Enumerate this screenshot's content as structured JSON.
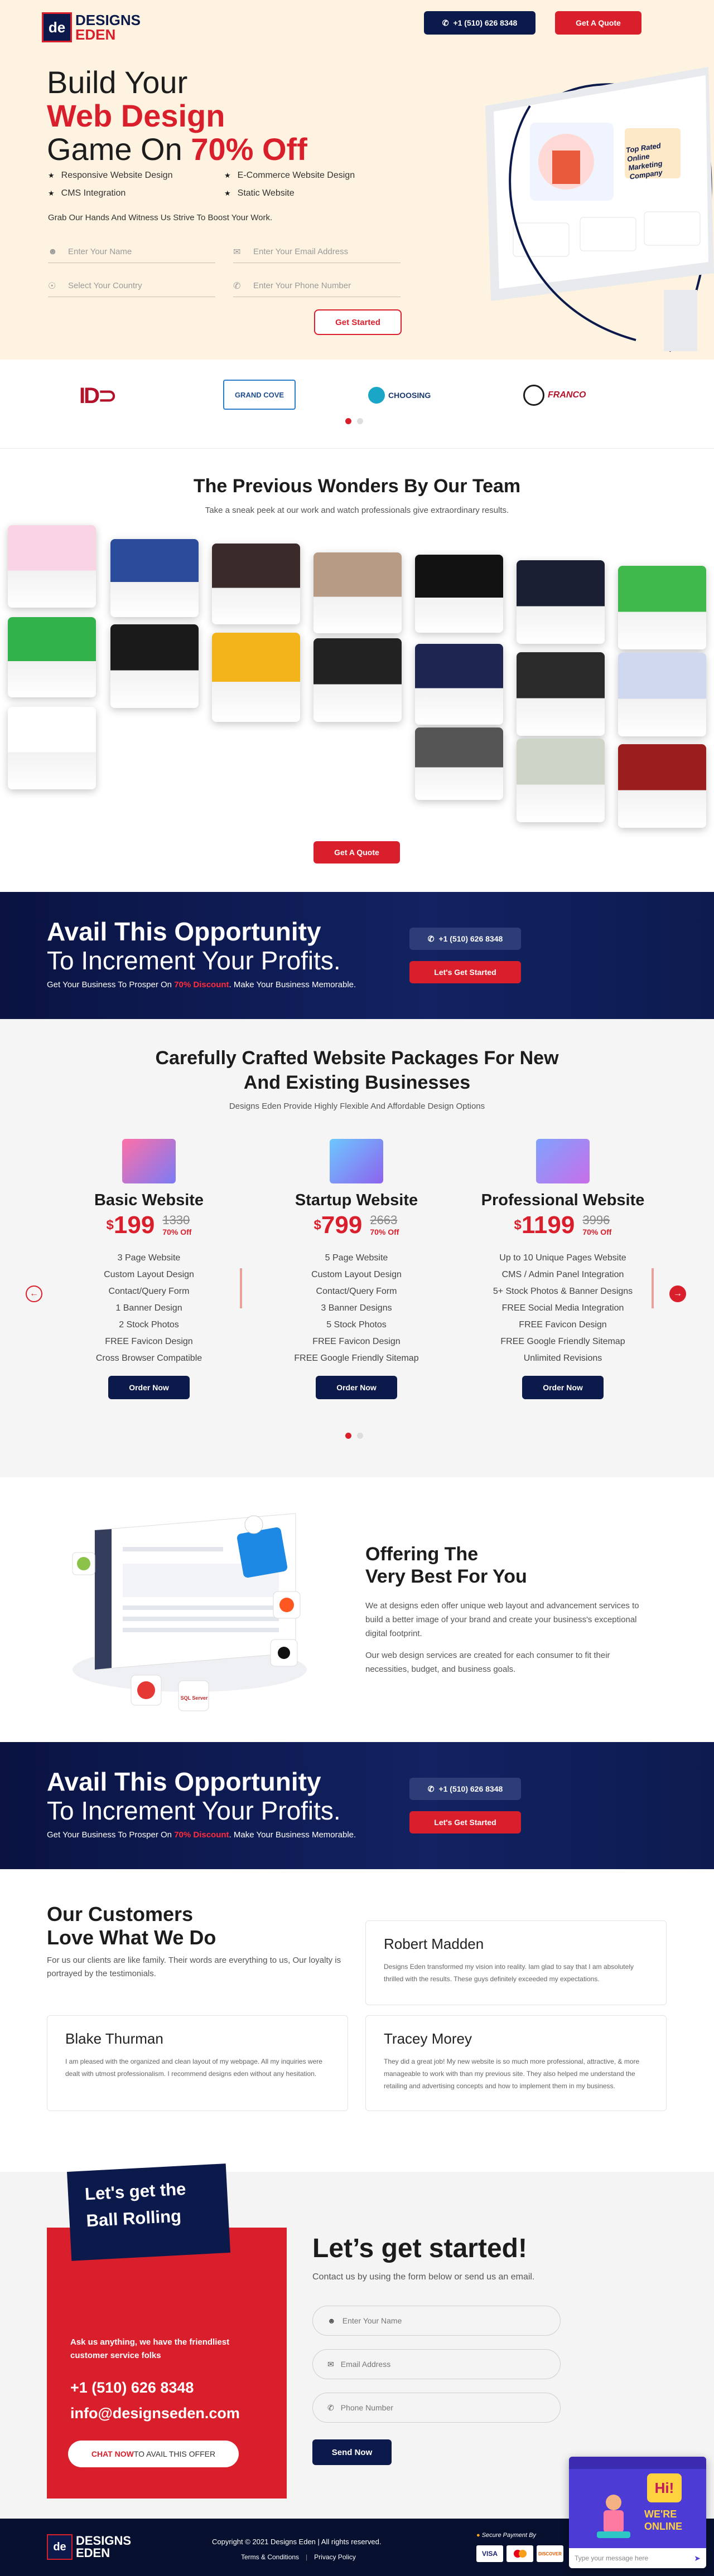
{
  "brand": {
    "line1": "DESIGNS",
    "line2": "EDEN",
    "mark": "de"
  },
  "header": {
    "phone": "+1 (510) 626 8348",
    "quote": "Get A Quote"
  },
  "hero": {
    "l1": "Build Your",
    "l2": "Web Design",
    "l3a": "Game On ",
    "l3b": "70% Off",
    "features": [
      "Responsive Website Design",
      "E-Commerce Website Design",
      "CMS Integration",
      "Static Website"
    ],
    "tagline": "Grab Our Hands And Witness Us Strive To Boost Your Work.",
    "fields": {
      "name": "Enter Your Name",
      "email": "Enter Your Email Address",
      "country": "Select Your Country",
      "phone": "Enter Your Phone Number"
    },
    "cta": "Get Started",
    "monitor": {
      "headline": "Top Rated Online Marketing Company"
    }
  },
  "clients": [
    "GRAND COVE",
    "CHOOSING",
    "FRANCO"
  ],
  "portfolio": {
    "title": "The Previous Wonders By Our Team",
    "subtitle": "Take a sneak peek at our work and watch professionals give extraordinary results.",
    "cta": "Get A Quote"
  },
  "banner": {
    "l1": "Avail This Opportunity",
    "l2": "To Increment Your Profits.",
    "l3a": "Get Your Business To Prosper On ",
    "l3b": "70% Discount",
    "l3c": ". Make Your Business Memorable.",
    "phone": "+1 (510) 626 8348",
    "cta": "Let's Get Started"
  },
  "packages": {
    "title1": "Carefully Crafted Website Packages For New",
    "title2": "And Existing Businesses",
    "subtitle": "Designs Eden Provide Highly Flexible And Affordable Design Options",
    "currency": "$",
    "off": "70% Off",
    "order": "Order Now",
    "items": [
      {
        "name": "Basic Website",
        "price": "199",
        "old": "1330",
        "features": [
          "3 Page Website",
          "Custom Layout Design",
          "Contact/Query Form",
          "1 Banner Design",
          "2 Stock Photos",
          "FREE Favicon Design",
          "Cross Browser Compatible"
        ]
      },
      {
        "name": "Startup Website",
        "price": "799",
        "old": "2663",
        "features": [
          "5 Page Website",
          "Custom Layout Design",
          "Contact/Query Form",
          "3 Banner Designs",
          "5 Stock Photos",
          "FREE Favicon Design",
          "FREE Google Friendly Sitemap"
        ]
      },
      {
        "name": "Professional Website",
        "price": "1199",
        "old": "3996",
        "features": [
          "Up to 10 Unique Pages Website",
          "CMS / Admin Panel Integration",
          "5+ Stock Photos & Banner Designs",
          "FREE Social Media Integration",
          "FREE Favicon Design",
          "FREE Google Friendly Sitemap",
          "Unlimited Revisions"
        ]
      }
    ]
  },
  "offering": {
    "title1": "Offering The",
    "title2": "Very Best For You",
    "p1": "We at designs eden offer unique web layout and advancement services to build a better image of your brand and create your business's exceptional digital footprint.",
    "p2": "Our web design services are created for each consumer to fit their necessities, budget, and business goals.",
    "sql": "SQL Server"
  },
  "testimonials": {
    "title1": "Our Customers",
    "title2": "Love What We Do",
    "intro": "For us our clients are like family. Their words are everything to us, Our loyalty is portrayed by the testimonials.",
    "items": [
      {
        "name": "Robert Madden",
        "text": "Designs Eden transformed my vision into reality. Iam glad to say that I am absolutely thrilled with the results. These guys definitely exceeded my expectations."
      },
      {
        "name": "Blake Thurman",
        "text": "I am pleased with the organized and clean layout of my webpage. All my inquiries were dealt with utmost professionalism. I recommend designs eden without any hesitation."
      },
      {
        "name": "Tracey Morey",
        "text": "They did a great job! My new website is so much more professional, attractive, & more manageable to work with than my previous site. They also helped me understand the retailing and advertising concepts and how to implement them in my business."
      }
    ]
  },
  "contact": {
    "badge1": "Let's get the",
    "badge2": "Ball Rolling",
    "ask": "Ask us anything, we have the friendliest customer service folks",
    "phone": "+1 (510) 626 8348",
    "email": "info@designseden.com",
    "chat_b": "CHAT NOW",
    "chat_r": " TO AVAIL THIS OFFER",
    "title": "Let’s get started!",
    "sub": "Contact us by using the form below or send us an email.",
    "fields": {
      "name": "Enter Your Name",
      "email": "Email Address",
      "phone": "Phone Number"
    },
    "send": "Send Now"
  },
  "footer": {
    "copy": "Copyright © 2021 Designs Eden | All rights reserved.",
    "terms": "Terms & Conditions",
    "privacy": "Privacy Policy",
    "secure": "Secure Payment By"
  },
  "chatwidget": {
    "hi": "Hi!",
    "online1": "WE'RE",
    "online2": "ONLINE",
    "placeholder": "Type your message here"
  }
}
